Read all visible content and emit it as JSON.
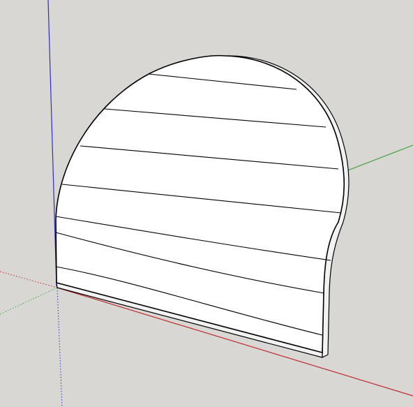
{
  "viewport": {
    "background": "#d8d7d3"
  },
  "axes": {
    "red_color": "#c02a2a",
    "green_color": "#3da23d",
    "blue_color": "#2d2dc8"
  },
  "model": {
    "panel_face_color": "#ffffff",
    "panel_edge_color": "#f2f2f2",
    "outline_color": "#000000",
    "plank_line_count": 7
  }
}
